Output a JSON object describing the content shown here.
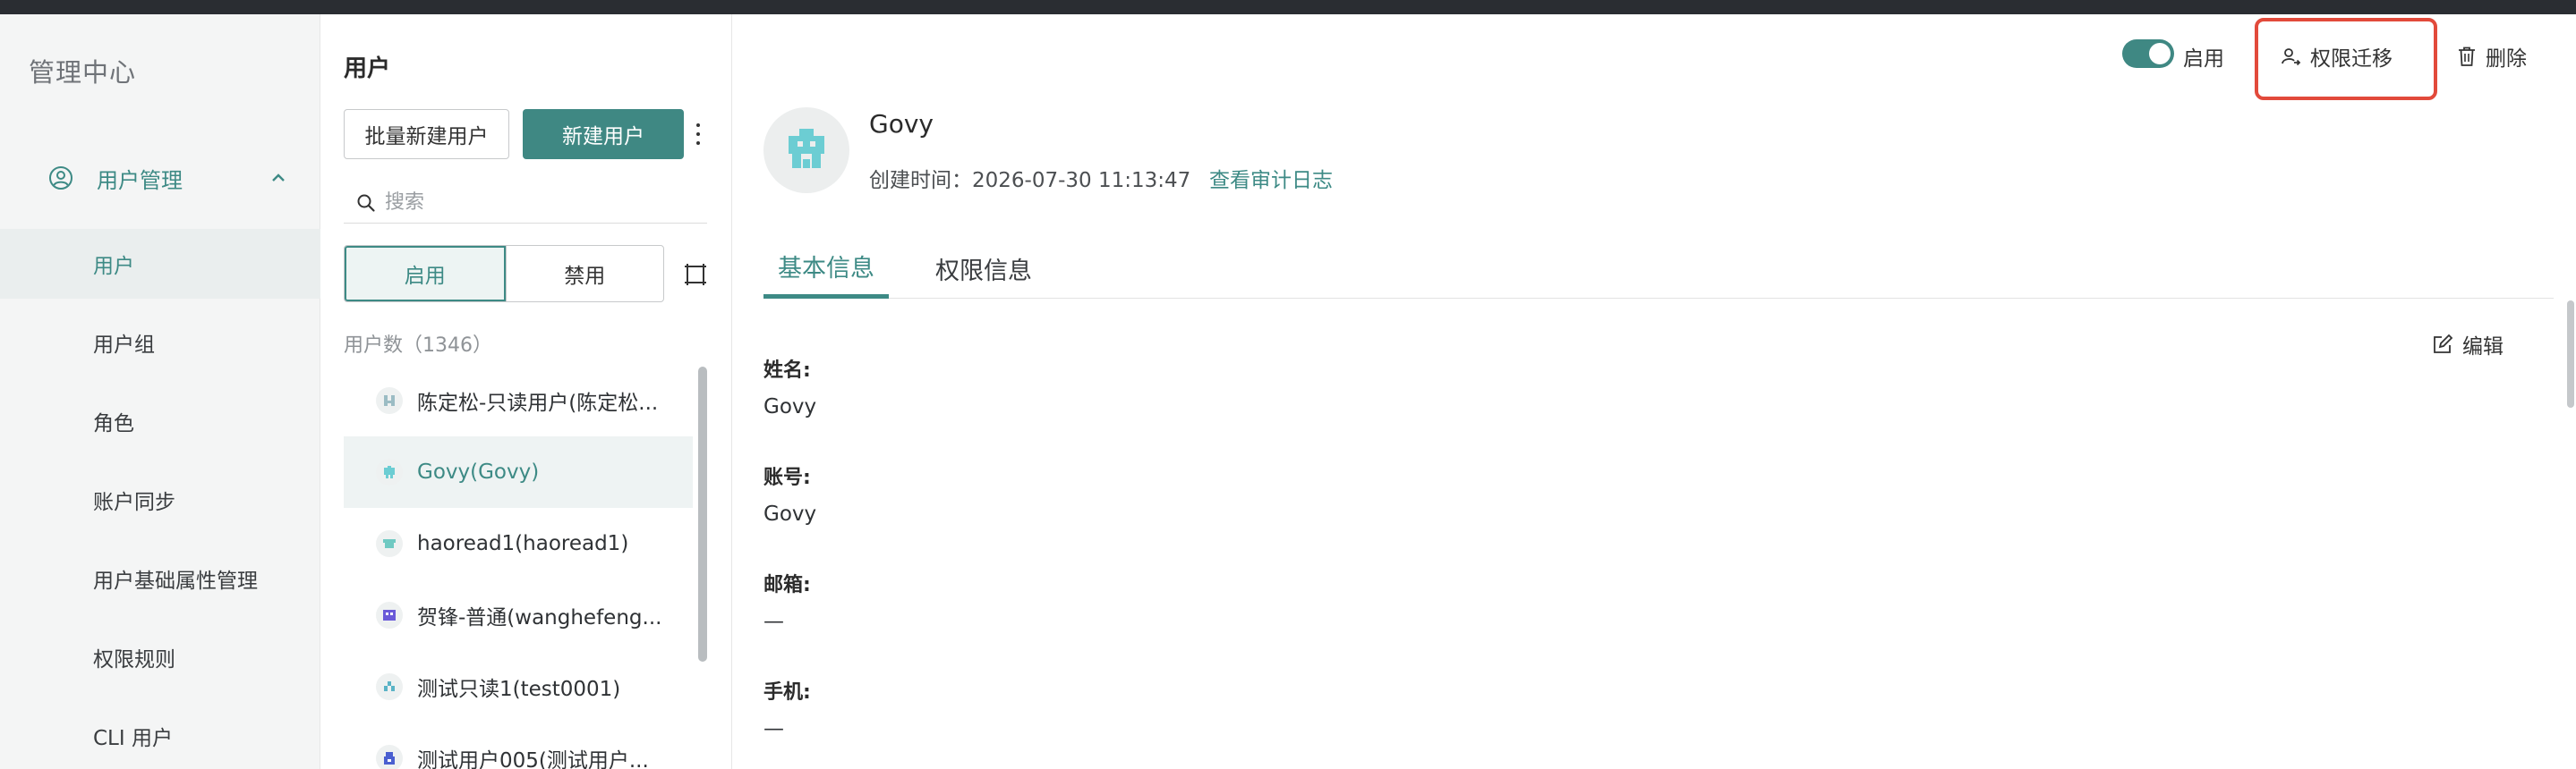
{
  "sidebar": {
    "brand": "管理中心",
    "group_label": "用户管理",
    "items": [
      {
        "label": "用户"
      },
      {
        "label": "用户组"
      },
      {
        "label": "角色"
      },
      {
        "label": "账户同步"
      },
      {
        "label": "用户基础属性管理"
      },
      {
        "label": "权限规则"
      },
      {
        "label": "CLI 用户"
      }
    ]
  },
  "users_panel": {
    "title": "用户",
    "batch_create_label": "批量新建用户",
    "create_label": "新建用户",
    "search_placeholder": "搜索",
    "filter_enabled": "启用",
    "filter_disabled": "禁用",
    "count_text": "用户数（1346）",
    "users": [
      {
        "name": "陈定松-只读用户(陈定松...",
        "avatar_color": "#9bbcc4"
      },
      {
        "name": "Govy(Govy)",
        "avatar_color": "#6ccdd3"
      },
      {
        "name": "haoread1(haoread1)",
        "avatar_color": "#6fc9c2"
      },
      {
        "name": "贺锋-普通(wanghefeng...",
        "avatar_color": "#6a5ad8"
      },
      {
        "name": "测试只读1(test0001)",
        "avatar_color": "#5ab3c6"
      },
      {
        "name": "测试用户005(测试用户...",
        "avatar_color": "#4a5fd0"
      }
    ]
  },
  "detail": {
    "toggle_label": "启用",
    "transfer_label": "权限迁移",
    "delete_label": "删除",
    "user_name": "Govy",
    "created_text": "创建时间：2026-07-30 11:13:47",
    "audit_link": "查看审计日志",
    "tabs": [
      "基本信息",
      "权限信息"
    ],
    "edit_label": "编辑",
    "fields": [
      {
        "label": "姓名:",
        "value": "Govy"
      },
      {
        "label": "账号:",
        "value": "Govy"
      },
      {
        "label": "邮箱:",
        "value": "—"
      },
      {
        "label": "手机:",
        "value": "—"
      }
    ]
  },
  "colors": {
    "accent": "#3f8883",
    "highlight": "#e24a3b"
  }
}
